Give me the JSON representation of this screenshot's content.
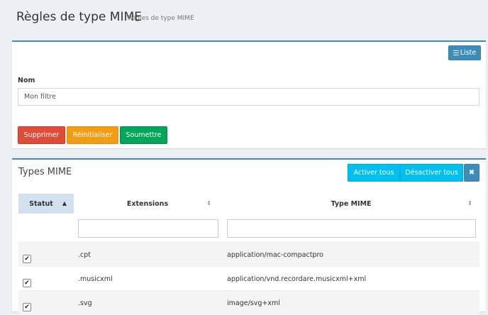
{
  "header": {
    "title": "Règles de type MIME",
    "subtitle": "Règles de type MIME"
  },
  "form": {
    "list_button": "Liste",
    "name_label": "Nom",
    "name_value": "Mon filtre",
    "delete_button": "Supprimer",
    "reset_button": "Réinitialiser",
    "submit_button": "Soumettre"
  },
  "mime": {
    "title": "Types MIME",
    "enable_all": "Activer tous",
    "disable_all": "Désactiver tous",
    "close_glyph": "✖",
    "columns": [
      "Statut",
      "Extensions",
      "Type MIME"
    ],
    "sort_glyph_active": "▲",
    "sort_glyph": "⇕",
    "check_glyph": "✔",
    "rows": [
      {
        "checked": true,
        "extension": ".cpt",
        "type": "application/mac-compactpro"
      },
      {
        "checked": true,
        "extension": ".musicxml",
        "type": "application/vnd.recordare.musicxml+xml"
      },
      {
        "checked": true,
        "extension": ".svg",
        "type": "image/svg+xml"
      }
    ]
  }
}
